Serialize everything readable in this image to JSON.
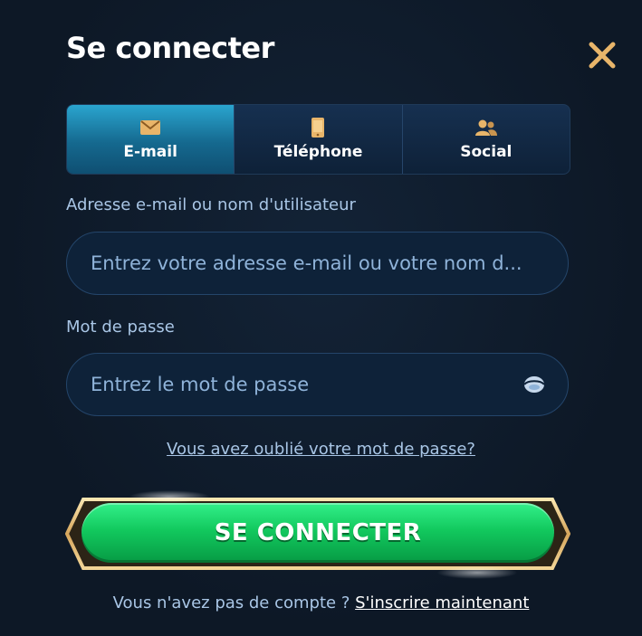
{
  "header": {
    "title": "Se connecter",
    "close_icon": "close-icon"
  },
  "tabs": [
    {
      "label": "E-mail",
      "icon": "envelope-icon",
      "active": true
    },
    {
      "label": "Téléphone",
      "icon": "phone-icon",
      "active": false
    },
    {
      "label": "Social",
      "icon": "users-icon",
      "active": false
    }
  ],
  "form": {
    "email_label": "Adresse e-mail ou nom d'utilisateur",
    "email_placeholder": "Entrez votre adresse e-mail ou votre nom d...",
    "email_value": "",
    "password_label": "Mot de passe",
    "password_placeholder": "Entrez le mot de passe",
    "password_value": "",
    "forgot_link": "Vous avez oublié votre mot de passe?",
    "submit_label": "SE CONNECTER"
  },
  "footer": {
    "prompt": "Vous n'avez pas de compte ? ",
    "signup_link": "S'inscrire maintenant"
  },
  "colors": {
    "background": "#0d1826",
    "accent_tab": "#2aa5cf",
    "icon_gold": "#e8b56a",
    "button_green": "#12c95e",
    "label_blue": "#a9c6e6"
  }
}
